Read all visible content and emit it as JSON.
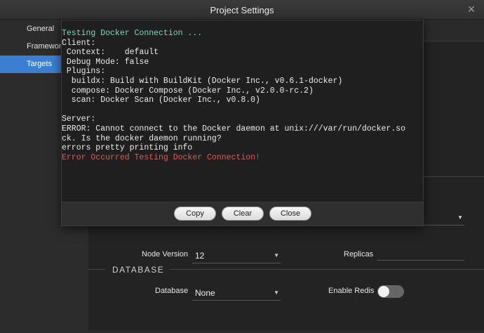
{
  "window": {
    "title": "Project Settings"
  },
  "sidebar": {
    "items": [
      {
        "label": "General"
      },
      {
        "label": "Frameworks"
      },
      {
        "label": "Targets"
      }
    ]
  },
  "form": {
    "node_version_label": "Node Version",
    "node_version_value": "12",
    "replicas_label": "Replicas",
    "replicas_value": "",
    "database_section": "DATABASE",
    "database_label": "Database",
    "database_value": "None",
    "enable_redis_label": "Enable Redis",
    "enable_redis_on": false
  },
  "dialog": {
    "lines": [
      {
        "text": "Testing Docker Connection ...",
        "style": "cyan"
      },
      {
        "text": "Client:",
        "style": ""
      },
      {
        "text": " Context:    default",
        "style": ""
      },
      {
        "text": " Debug Mode: false",
        "style": ""
      },
      {
        "text": " Plugins:",
        "style": ""
      },
      {
        "text": "  buildx: Build with BuildKit (Docker Inc., v0.6.1-docker)",
        "style": ""
      },
      {
        "text": "  compose: Docker Compose (Docker Inc., v2.0.0-rc.2)",
        "style": ""
      },
      {
        "text": "  scan: Docker Scan (Docker Inc., v0.8.0)",
        "style": ""
      },
      {
        "text": "",
        "style": ""
      },
      {
        "text": "Server:",
        "style": ""
      },
      {
        "text": "ERROR: Cannot connect to the Docker daemon at unix:///var/run/docker.so",
        "style": ""
      },
      {
        "text": "ck. Is the docker daemon running?",
        "style": ""
      },
      {
        "text": "errors pretty printing info",
        "style": ""
      },
      {
        "text": "Error Occurred Testing Docker Connection!",
        "style": "red"
      }
    ],
    "buttons": {
      "copy": "Copy",
      "clear": "Clear",
      "close": "Close"
    }
  },
  "colors": {
    "accent": "#3b7fd3",
    "console_info": "#7fd4c4",
    "console_error": "#e0585a"
  }
}
